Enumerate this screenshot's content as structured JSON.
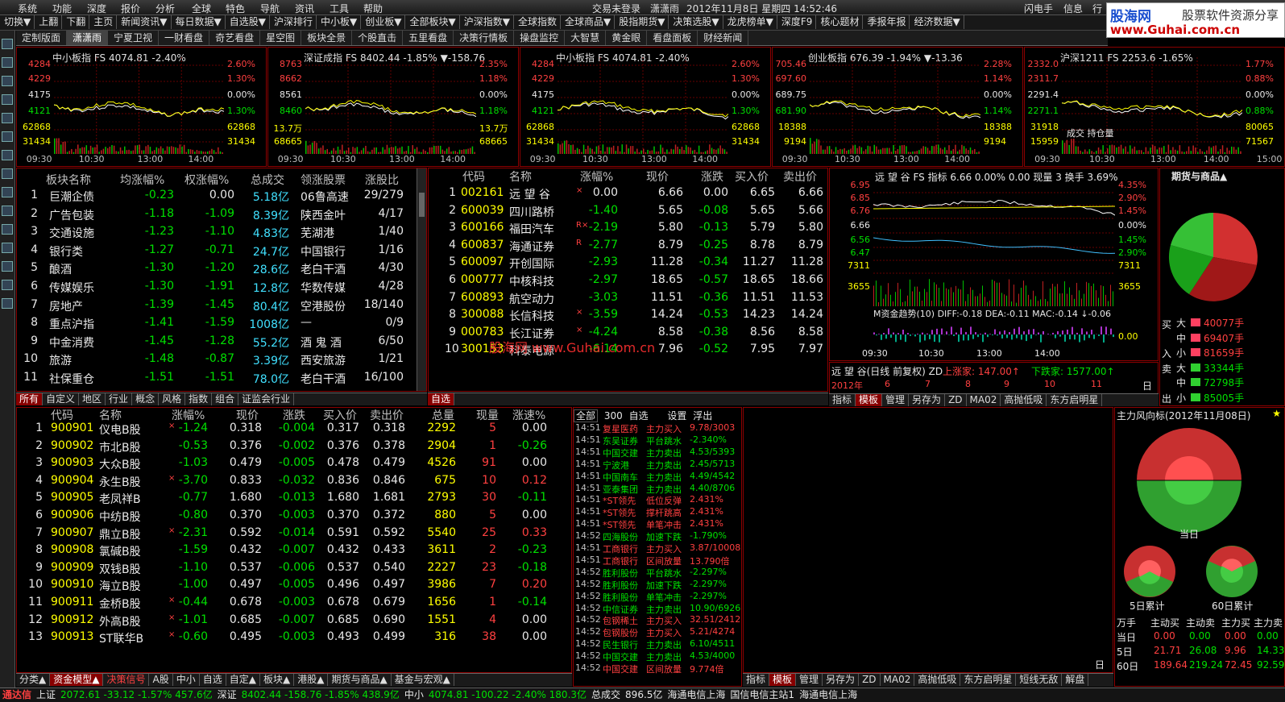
{
  "menu": {
    "items": [
      "系统",
      "功能",
      "深度",
      "报价",
      "分析",
      "全球",
      "特色",
      "导航",
      "资讯",
      "工具",
      "帮助"
    ],
    "login": "交易未登录",
    "user": "潇潇雨",
    "datetime": "2012年11月8日 星期四 14:52:46",
    "right": [
      "闪电手",
      "信息",
      "行"
    ]
  },
  "toolbar": {
    "items": [
      "切换▼",
      "上翻",
      "下翻",
      "主页",
      "新闻资讯▼",
      "每日数据▼",
      "自选股▼",
      "沪深排行",
      "中小板▼",
      "创业板▼",
      "全部板块▼",
      "沪深指数▼",
      "全球指数",
      "全球商品▼",
      "股指期货▼",
      "决策选股▼",
      "龙虎榜单▼",
      "深度F9",
      "核心题材",
      "季报年报",
      "经济数据▼"
    ]
  },
  "logo": {
    "name": "股海网",
    "slogan": "股票软件资源分享",
    "url": "www.Guhai.com.cn"
  },
  "tabs": [
    "定制版面",
    "潇潇雨",
    "宁夏卫视",
    "一财看盘",
    "奇艺看盘",
    "星空图",
    "板块全景",
    "个股直击",
    "五里看盘",
    "决策行情板",
    "操盘监控",
    "大智慧",
    "黄金眼",
    "看盘面板",
    "财经新闻"
  ],
  "minicharts": [
    {
      "title": "中小板指 FS 4074.81 -2.40%",
      "left": [
        "4284",
        "4229",
        "4175",
        "4121",
        "62868",
        "31434"
      ],
      "right": [
        "2.60%",
        "1.30%",
        "0.00%",
        "1.30%",
        "62868",
        "31434"
      ],
      "times": [
        "09:30",
        "10:30",
        "13:00",
        "14:00"
      ]
    },
    {
      "title": "深证成指 FS 8402.44 -1.85% ▼-158.76",
      "left": [
        "8763",
        "8662",
        "8561",
        "8460",
        "13.7万",
        "68665"
      ],
      "right": [
        "2.35%",
        "1.18%",
        "0.00%",
        "1.18%",
        "13.7万",
        "68665"
      ],
      "times": [
        "09:30",
        "10:30",
        "13:00",
        "14:00"
      ]
    },
    {
      "title": "中小板指 FS 4074.81 -2.40%",
      "left": [
        "4284",
        "4229",
        "4175",
        "4121",
        "62868",
        "31434"
      ],
      "right": [
        "2.60%",
        "1.30%",
        "0.00%",
        "1.30%",
        "62868",
        "31434"
      ],
      "times": [
        "09:30",
        "10:30",
        "13:00",
        "14:00"
      ]
    },
    {
      "title": "创业板指 676.39 -1.94% ▼-13.36",
      "left": [
        "705.46",
        "697.60",
        "689.75",
        "681.90",
        "18388",
        "9194"
      ],
      "right": [
        "2.28%",
        "1.14%",
        "0.00%",
        "1.14%",
        "18388",
        "9194"
      ],
      "times": [
        "09:30",
        "10:30",
        "13:00",
        "14:00"
      ]
    },
    {
      "title": "沪深1211 FS 2253.6 -1.65%",
      "left": [
        "2332.0",
        "2311.7",
        "2291.4",
        "2271.1",
        "31918",
        "15959"
      ],
      "right": [
        "1.77%",
        "0.88%",
        "0.00%",
        "0.88%",
        "80065",
        "71567"
      ],
      "times": [
        "09:30",
        "10:30",
        "13:00",
        "14:00",
        "15:00"
      ],
      "note": "成交 持仓量"
    }
  ],
  "sectors": {
    "headers": [
      "板块名称",
      "均涨幅%",
      "权涨幅%",
      "总成交",
      "领涨股票",
      "涨股比"
    ],
    "rows": [
      [
        "1",
        "巨潮企债",
        "-0.23",
        "0.00",
        "5.18亿",
        "06鲁高速",
        "29/279"
      ],
      [
        "2",
        "广告包装",
        "-1.18",
        "-1.09",
        "8.39亿",
        "陕西金叶",
        "4/17"
      ],
      [
        "3",
        "交通设施",
        "-1.23",
        "-1.10",
        "4.83亿",
        "芜湖港",
        "1/40"
      ],
      [
        "4",
        "银行类",
        "-1.27",
        "-0.71",
        "24.7亿",
        "中国银行",
        "1/16"
      ],
      [
        "5",
        "酿酒",
        "-1.30",
        "-1.20",
        "28.6亿",
        "老白干酒",
        "4/30"
      ],
      [
        "6",
        "传媒娱乐",
        "-1.30",
        "-1.91",
        "12.8亿",
        "华数传媒",
        "4/28"
      ],
      [
        "7",
        "房地产",
        "-1.39",
        "-1.45",
        "80.4亿",
        "空港股份",
        "18/140"
      ],
      [
        "8",
        "重点沪指",
        "-1.41",
        "-1.59",
        "1008亿",
        "—",
        "0/9"
      ],
      [
        "9",
        "中金消费",
        "-1.45",
        "-1.28",
        "55.2亿",
        "酒 鬼 酒",
        "6/50"
      ],
      [
        "10",
        "旅游",
        "-1.48",
        "-0.87",
        "3.39亿",
        "西安旅游",
        "1/21"
      ],
      [
        "11",
        "社保重仓",
        "-1.51",
        "-1.51",
        "78.0亿",
        "老白干酒",
        "16/100"
      ]
    ]
  },
  "sector_tabs": [
    "所有",
    "自定义",
    "地区",
    "行业",
    "概念",
    "风格",
    "指数",
    "组合",
    "证监会行业"
  ],
  "watch": {
    "headers": [
      "代码",
      "名称",
      "涨幅%",
      "现价",
      "涨跌",
      "买入价",
      "卖出价"
    ],
    "rows": [
      [
        "1",
        "002161",
        "远 望 谷",
        "×",
        "0.00",
        "6.66",
        "0.00",
        "6.65",
        "6.66"
      ],
      [
        "2",
        "600039",
        "四川路桥",
        "",
        "-1.40",
        "5.65",
        "-0.08",
        "5.65",
        "5.66"
      ],
      [
        "3",
        "600166",
        "福田汽车",
        "R×",
        "-2.19",
        "5.80",
        "-0.13",
        "5.79",
        "5.80"
      ],
      [
        "4",
        "600837",
        "海通证券",
        "R",
        "-2.77",
        "8.79",
        "-0.25",
        "8.78",
        "8.79"
      ],
      [
        "5",
        "600097",
        "开创国际",
        "",
        "-2.93",
        "11.28",
        "-0.34",
        "11.27",
        "11.28"
      ],
      [
        "6",
        "000777",
        "中核科技",
        "",
        "-2.97",
        "18.65",
        "-0.57",
        "18.65",
        "18.66"
      ],
      [
        "7",
        "600893",
        "航空动力",
        "",
        "-3.03",
        "11.51",
        "-0.36",
        "11.51",
        "11.53"
      ],
      [
        "8",
        "300088",
        "长信科技",
        "×",
        "-3.59",
        "14.24",
        "-0.53",
        "14.23",
        "14.24"
      ],
      [
        "9",
        "000783",
        "长江证券",
        "×",
        "-4.24",
        "8.58",
        "-0.38",
        "8.56",
        "8.58"
      ],
      [
        "10",
        "300153",
        "科泰电源",
        "",
        "-6.14",
        "7.96",
        "-0.52",
        "7.95",
        "7.97"
      ]
    ],
    "tab": "自选",
    "watermark": "股海网 www.Guhai.com.cn"
  },
  "stockchart": {
    "title": "远 望 谷 FS 指标 6.66 0.00% 0.00 现量 3 换手 3.69%",
    "left": [
      "6.95",
      "6.85",
      "6.76",
      "6.66",
      "6.56",
      "6.47",
      "7311",
      "3655"
    ],
    "right": [
      "4.35%",
      "2.90%",
      "1.45%",
      "0.00%",
      "1.45%",
      "2.90%",
      "7311",
      "3655",
      "0.00"
    ],
    "indicator": "M资金趋势(10) DIFF:-0.18 DEA:-0.11 MAC:-0.14 ↓-0.06",
    "times": [
      "09:30",
      "10:30",
      "13:00",
      "14:00"
    ],
    "daily": "远 望 谷(日线 前复权) ZD",
    "up": "上涨家: 147.00↑",
    "down": "下跌家: 1577.00↑",
    "months": [
      "2012年",
      "6",
      "7",
      "8",
      "9",
      "10",
      "11"
    ],
    "dayline": "日线"
  },
  "bottom_tabs_mid": [
    "指标",
    "模板",
    "管理",
    "另存为",
    "ZD",
    "MA02",
    "高抛低吸",
    "东方启明星"
  ],
  "futures": {
    "title": "期货与商品▲",
    "buy_label": "买",
    "sell_label": "卖",
    "in_label": "入",
    "out_label": "出",
    "rows": [
      [
        "大",
        "40077手"
      ],
      [
        "中",
        "69407手"
      ],
      [
        "小",
        "81659手"
      ],
      [
        "大",
        "33344手"
      ],
      [
        "中",
        "72798手"
      ],
      [
        "小",
        "85005手"
      ]
    ]
  },
  "bshares": {
    "headers": [
      "代码",
      "名称",
      "涨幅%",
      "现价",
      "涨跌",
      "买入价",
      "卖出价",
      "总量",
      "现量",
      "涨速%"
    ],
    "rows": [
      [
        "1",
        "900901",
        "仪电B股",
        "×",
        "-1.24",
        "0.318",
        "-0.004",
        "0.317",
        "0.318",
        "2292",
        "5",
        "0.00"
      ],
      [
        "2",
        "900902",
        "市北B股",
        "",
        "-0.53",
        "0.376",
        "-0.002",
        "0.376",
        "0.378",
        "2904",
        "1",
        "-0.26"
      ],
      [
        "3",
        "900903",
        "大众B股",
        "",
        "-1.03",
        "0.479",
        "-0.005",
        "0.478",
        "0.479",
        "4526",
        "91",
        "0.00"
      ],
      [
        "4",
        "900904",
        "永生B股",
        "×",
        "-3.70",
        "0.833",
        "-0.032",
        "0.836",
        "0.846",
        "675",
        "10",
        "0.12"
      ],
      [
        "5",
        "900905",
        "老凤祥B",
        "",
        "-0.77",
        "1.680",
        "-0.013",
        "1.680",
        "1.681",
        "2793",
        "30",
        "-0.11"
      ],
      [
        "6",
        "900906",
        "中纺B股",
        "",
        "-0.80",
        "0.370",
        "-0.003",
        "0.370",
        "0.372",
        "880",
        "5",
        "0.00"
      ],
      [
        "7",
        "900907",
        "鼎立B股",
        "×",
        "-2.31",
        "0.592",
        "-0.014",
        "0.591",
        "0.592",
        "5540",
        "25",
        "0.33"
      ],
      [
        "8",
        "900908",
        "氯碱B股",
        "",
        "-1.59",
        "0.432",
        "-0.007",
        "0.432",
        "0.433",
        "3611",
        "2",
        "-0.23"
      ],
      [
        "9",
        "900909",
        "双钱B股",
        "",
        "-1.10",
        "0.537",
        "-0.006",
        "0.537",
        "0.540",
        "2227",
        "23",
        "-0.18"
      ],
      [
        "10",
        "900910",
        "海立B股",
        "",
        "-1.00",
        "0.497",
        "-0.005",
        "0.496",
        "0.497",
        "3986",
        "7",
        "0.20"
      ],
      [
        "11",
        "900911",
        "金桥B股",
        "×",
        "-0.44",
        "0.678",
        "-0.003",
        "0.678",
        "0.679",
        "1656",
        "1",
        "-0.14"
      ],
      [
        "12",
        "900912",
        "外高B股",
        "×",
        "-1.01",
        "0.685",
        "-0.007",
        "0.685",
        "0.690",
        "1551",
        "4",
        "0.00"
      ],
      [
        "13",
        "900913",
        "ST联华B",
        "×",
        "-0.60",
        "0.495",
        "-0.003",
        "0.493",
        "0.499",
        "316",
        "38",
        "0.00"
      ]
    ]
  },
  "bottom_tabs_left": [
    "分类▲",
    "资金模型▲",
    "决策信号",
    "A股",
    "中小",
    "自选",
    "自定▲",
    "板块▲",
    "港股▲",
    "期货与商品▲",
    "基金与宏观▲"
  ],
  "signals": {
    "tabs": [
      "全部",
      "300",
      "自选"
    ],
    "right_tabs": [
      "设置",
      "浮出"
    ],
    "rows": [
      [
        "14:51",
        "复星医药",
        "主力买入",
        "9.78/3003"
      ],
      [
        "14:51",
        "东吴证券",
        "平台跳水",
        "-2.340%"
      ],
      [
        "14:51",
        "中国交建",
        "主力卖出",
        "4.53/5393"
      ],
      [
        "14:51",
        "宁波港",
        "主力卖出",
        "2.45/5713"
      ],
      [
        "14:51",
        "中国南车",
        "主力卖出",
        "4.49/4542"
      ],
      [
        "14:51",
        "亚泰集团",
        "主力卖出",
        "4.40/8706"
      ],
      [
        "14:51",
        "*ST领先",
        "低位反弹",
        "2.431%"
      ],
      [
        "14:51",
        "*ST领先",
        "撑杆跳高",
        "2.431%"
      ],
      [
        "14:51",
        "*ST领先",
        "单笔冲击",
        "2.431%"
      ],
      [
        "14:52",
        "四海股份",
        "加速下跌",
        "-1.790%"
      ],
      [
        "14:51",
        "工商银行",
        "主力买入",
        "3.87/10008"
      ],
      [
        "14:51",
        "工商银行",
        "区间放量",
        "13.790倍"
      ],
      [
        "14:52",
        "胜利股份",
        "平台跳水",
        "-2.297%"
      ],
      [
        "14:52",
        "胜利股份",
        "加速下跌",
        "-2.297%"
      ],
      [
        "14:52",
        "胜利股份",
        "单笔冲击",
        "-2.297%"
      ],
      [
        "14:52",
        "中信证券",
        "主力卖出",
        "10.90/6926"
      ],
      [
        "14:52",
        "包钢稀土",
        "主力买入",
        "32.51/2412"
      ],
      [
        "14:52",
        "包钢股份",
        "主力买入",
        "5.21/4274"
      ],
      [
        "14:52",
        "民生银行",
        "主力卖出",
        "6.10/4511"
      ],
      [
        "14:52",
        "中国交建",
        "主力卖出",
        "4.53/4000"
      ],
      [
        "14:52",
        "中国交建",
        "区间放量",
        "9.774倍"
      ]
    ]
  },
  "bottom_tabs_mid2": [
    "指标",
    "模板",
    "管理",
    "另存为",
    "ZD",
    "MA02",
    "高抛低吸",
    "东方启明星",
    "短线无敌",
    "解盘"
  ],
  "dayline2": "日线",
  "fund": {
    "title": "主力风向标(2012年11月08日)",
    "today": "当日",
    "d5": "5日累计",
    "d60": "60日累计",
    "headers": [
      "万手",
      "主动买",
      "主动卖",
      "主力买",
      "主力卖"
    ],
    "rows": [
      [
        "当日",
        "0.00",
        "0.00",
        "0.00",
        "0.00"
      ],
      [
        "5日",
        "21.71",
        "26.08",
        "9.96",
        "14.33"
      ],
      [
        "60日",
        "189.64",
        "219.24",
        "72.45",
        "92.59"
      ]
    ]
  },
  "status": {
    "items": [
      [
        "通达信",
        ""
      ],
      [
        "上证",
        "2072.61  -33.12  -1.57%  457.6亿"
      ],
      [
        "深证",
        "8402.44  -158.76  -1.85%  438.9亿"
      ],
      [
        "中小",
        "4074.81  -100.22  -2.40%  180.3亿"
      ],
      [
        "总成交",
        "896.5亿"
      ],
      [
        "海通电信上海",
        ""
      ],
      [
        "国信电信主站1",
        ""
      ],
      [
        "海通电信上海",
        ""
      ]
    ]
  },
  "colors": {
    "up": "#ff4040",
    "down": "#00e000",
    "border": "#8b0000",
    "bg": "#000000"
  }
}
